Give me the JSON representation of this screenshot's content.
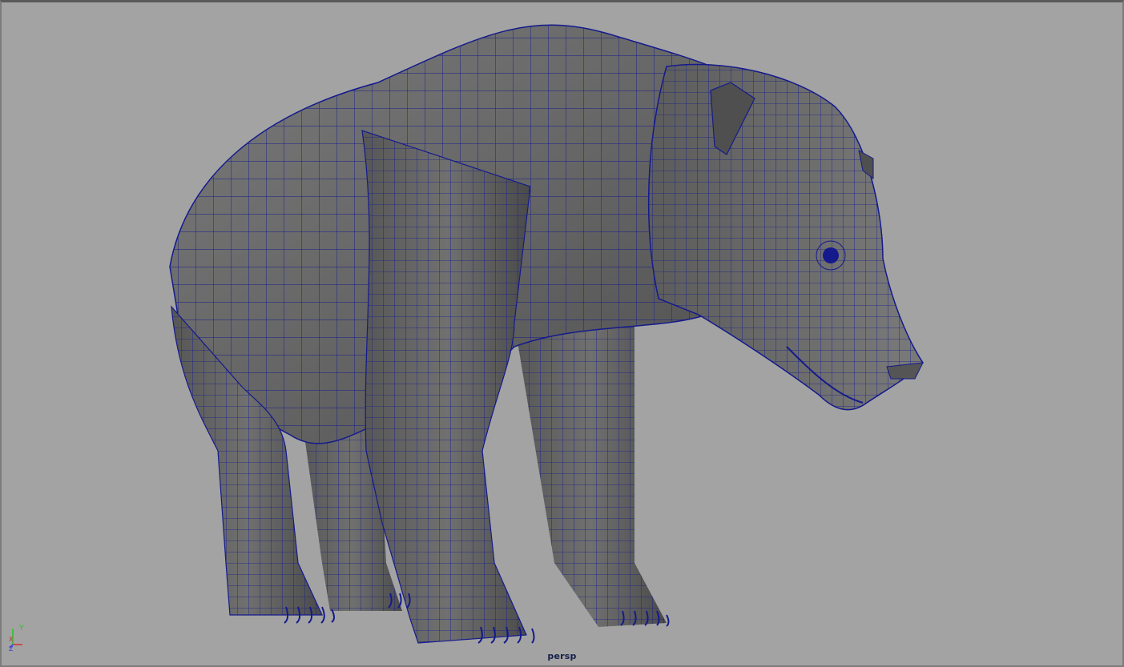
{
  "viewport": {
    "camera_label": "persp",
    "background_color": "#a3a3a3",
    "wireframe_color": "#141a8c",
    "shading_color": "#6b6b6b"
  },
  "axis_gizmo": {
    "y_label": "Y",
    "x_label": "X",
    "z_label": "Z",
    "y_color": "#29c429",
    "x_color": "#d33030",
    "z_color": "#3a3ad8"
  },
  "model": {
    "icon": "bear-mesh"
  }
}
